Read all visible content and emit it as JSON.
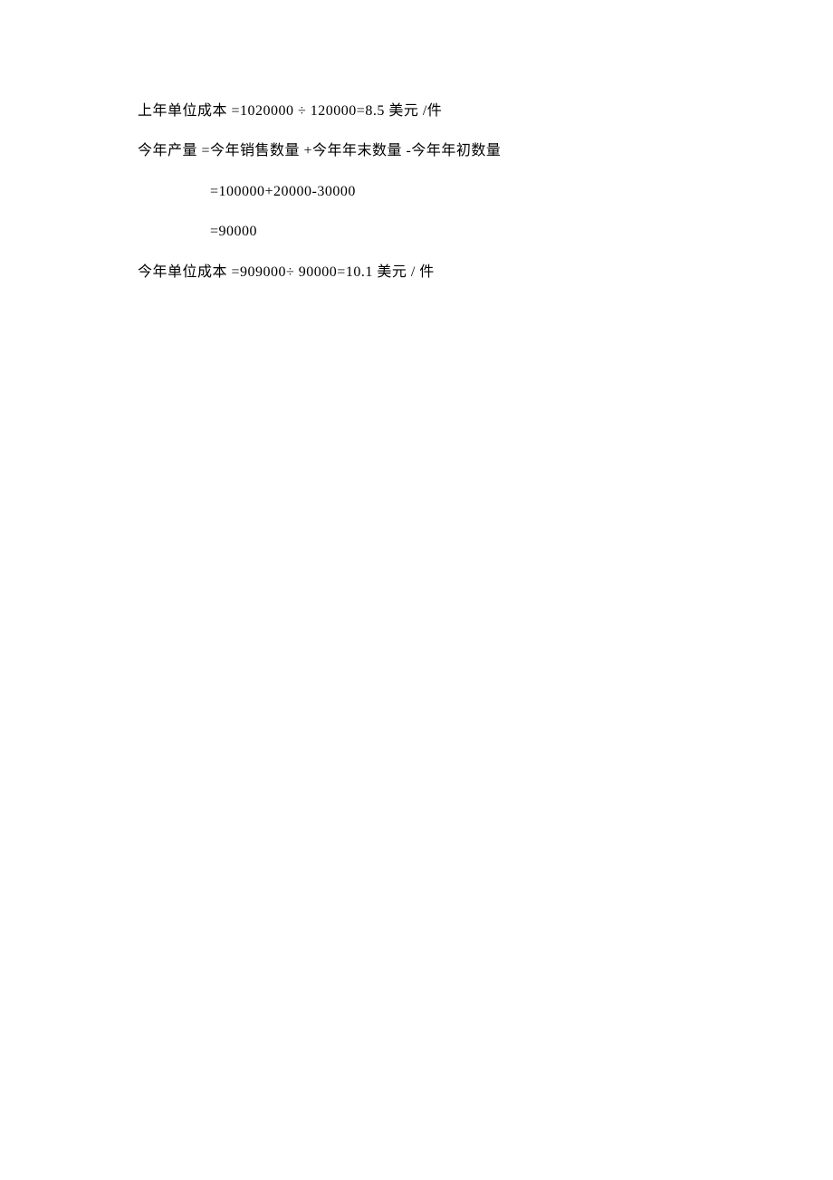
{
  "lines": {
    "l1": "上年单位成本  =1020000 ÷ 120000=8.5 美元 /件",
    "l2": "今年产量 =今年销售数量  +今年年末数量     -今年年初数量",
    "l3": "=100000+20000-30000",
    "l4": "=90000",
    "l5": "今年单位成本  =909000÷ 90000=10.1 美元 / 件"
  }
}
